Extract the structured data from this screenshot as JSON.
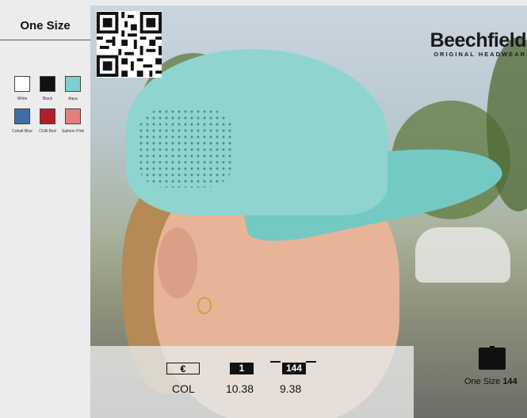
{
  "size": {
    "title": "One Size"
  },
  "colours": [
    {
      "name": "White",
      "hex": "#ffffff"
    },
    {
      "name": "Black",
      "hex": "#111111"
    },
    {
      "name": "Aqua",
      "hex": "#7fcfd0"
    },
    {
      "name": "Cobalt Blue",
      "hex": "#3e6ea5"
    },
    {
      "name": "Chilli Red",
      "hex": "#b01e2a"
    },
    {
      "name": "Salmon Pink",
      "hex": "#e57f7b"
    }
  ],
  "brand": {
    "name": "Beechfield",
    "tagline": "ORIGINAL HEADWEAR"
  },
  "pricing": {
    "currency_label": "€",
    "qty_1_label": "1",
    "qty_144_label": "144",
    "row_label": "COL",
    "price_1": "10.38",
    "price_144": "9.38"
  },
  "pack": {
    "size_label": "One Size",
    "quantity": "144"
  }
}
